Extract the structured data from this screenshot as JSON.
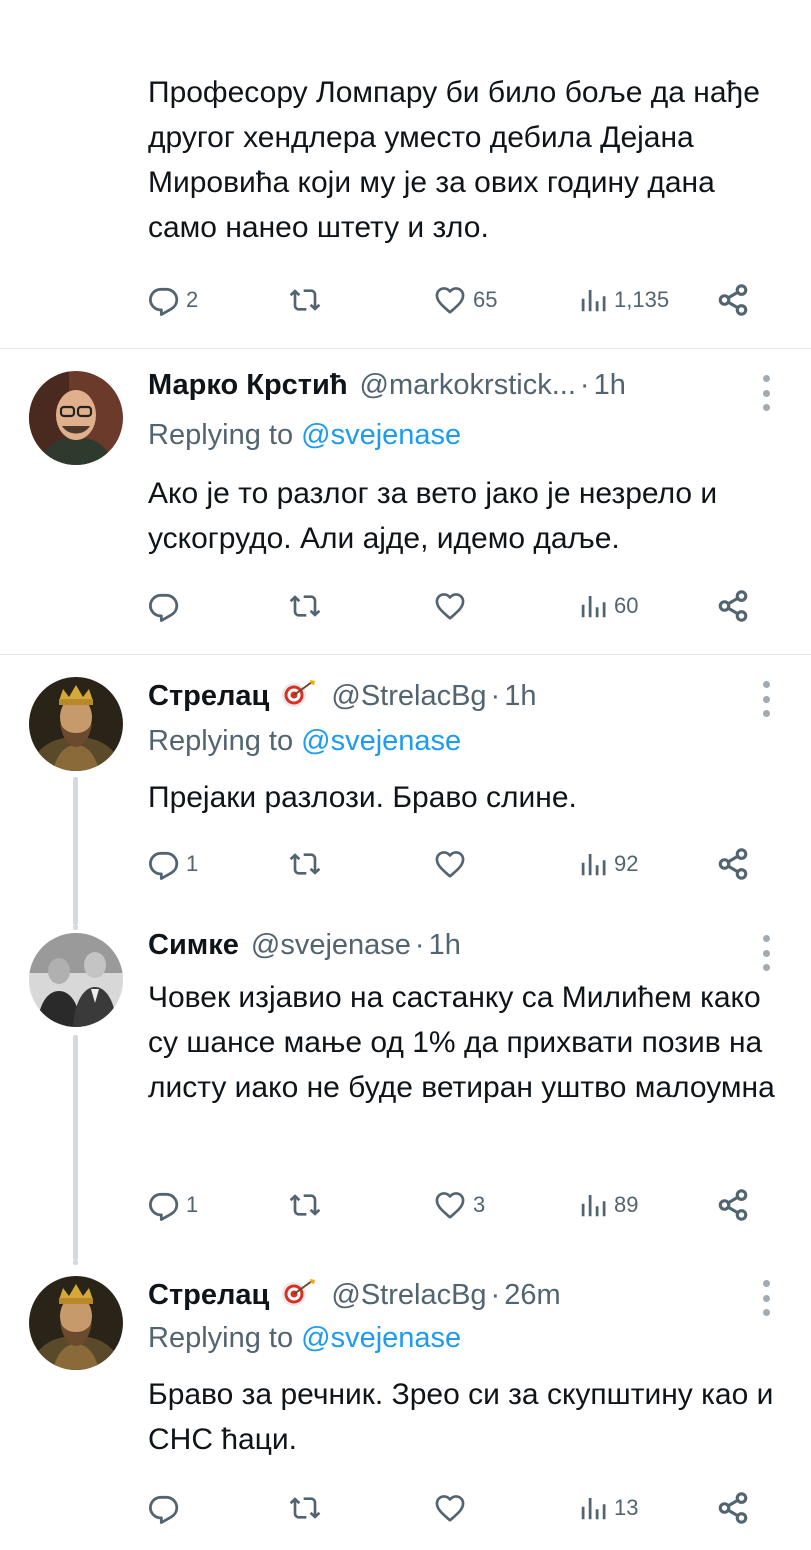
{
  "top_post": {
    "text": "Професору Ломпару би било боље да нађе другог хендлера уместо дебила Дејана Мировића који му је за ових годину дана само нанео штету и зло.",
    "replies": "2",
    "likes": "65",
    "views": "1,135"
  },
  "posts": [
    {
      "name": "Марко Крстић",
      "handle": "@markokrstick...",
      "time": "1h",
      "replying_prefix": "Replying to",
      "replying_to": "@svejenase",
      "text": "Ако је то разлог за вето јако је незрело и ускогрудо. Али ајде, идемо даље.",
      "replies": "",
      "likes": "",
      "views": "60"
    },
    {
      "name": "Стрелац",
      "handle": "@StrelacBg",
      "time": "1h",
      "replying_prefix": "Replying to",
      "replying_to": "@svejenase",
      "text": "Прејаки разлози. Браво слине.",
      "replies": "1",
      "likes": "",
      "views": "92"
    },
    {
      "name": "Симке",
      "handle": "@svejenase",
      "time": "1h",
      "text": "Човек изјавио на састанку са Милићем како су шансе мање од 1% да прихвати позив на листу иако не буде ветиран уштво малоумна",
      "replies": "1",
      "likes": "3",
      "views": "89"
    },
    {
      "name": "Стрелац",
      "handle": "@StrelacBg",
      "time": "26m",
      "replying_prefix": "Replying to",
      "replying_to": "@svejenase",
      "text": "Браво за речник. Зрео си за скупштину као и СНС ћаци.",
      "replies": "",
      "likes": "",
      "views": "13"
    }
  ],
  "icons": {
    "reply": "reply-icon",
    "retweet": "retweet-icon",
    "like": "heart-icon",
    "views": "views-icon",
    "share": "share-icon",
    "more": "more-icon",
    "emoji": "archery-target-icon"
  },
  "colors": {
    "text": "#0f1419",
    "muted": "#536471",
    "mention": "#1d9bf0",
    "divider": "#e6e9ec"
  }
}
